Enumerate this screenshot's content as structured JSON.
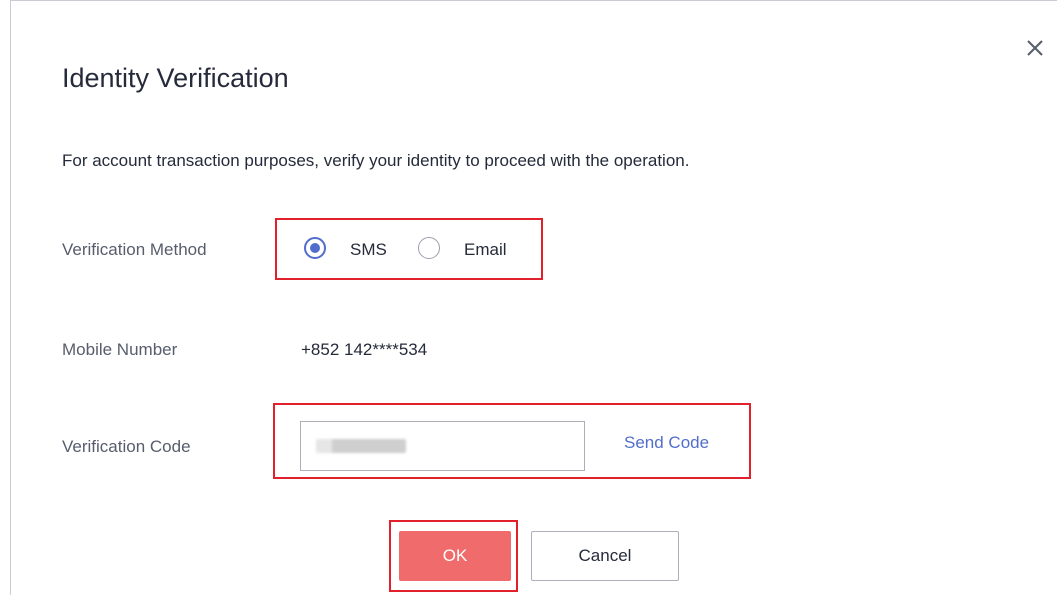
{
  "dialog": {
    "title": "Identity Verification",
    "description": "For account transaction purposes, verify your identity to proceed with the operation.",
    "close_icon": "close-icon"
  },
  "form": {
    "method_label": "Verification Method",
    "methods": [
      {
        "label": "SMS",
        "selected": true
      },
      {
        "label": "Email",
        "selected": false
      }
    ],
    "mobile_label": "Mobile Number",
    "mobile_value": "+852 142****534",
    "code_label": "Verification Code",
    "code_value": "",
    "send_code_label": "Send Code"
  },
  "buttons": {
    "ok_label": "OK",
    "cancel_label": "Cancel"
  },
  "colors": {
    "accent": "#526ecc",
    "primary_button": "#f06b6b",
    "highlight": "#e0202b"
  }
}
